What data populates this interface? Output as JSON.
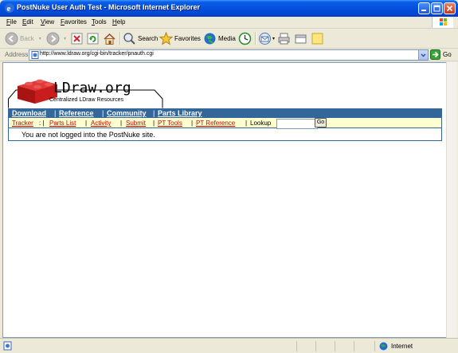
{
  "window": {
    "title": "PostNuke User Auth Test - Microsoft Internet Explorer"
  },
  "menu": {
    "items": [
      {
        "label": "File",
        "key": "F",
        "rest": "ile"
      },
      {
        "label": "Edit",
        "key": "E",
        "rest": "dit"
      },
      {
        "label": "View",
        "key": "V",
        "rest": "iew"
      },
      {
        "label": "Favorites",
        "key": "F",
        "rest": "avorites"
      },
      {
        "label": "Tools",
        "key": "T",
        "rest": "ools"
      },
      {
        "label": "Help",
        "key": "H",
        "rest": "elp"
      }
    ]
  },
  "toolbar": {
    "back_label": "Back",
    "search_label": "Search",
    "favorites_label": "Favorites",
    "media_label": "Media"
  },
  "address": {
    "label": "Address",
    "url": "http://www.ldraw.org/cgi-bin/tracker/pnauth.cgi",
    "go_label": "Go"
  },
  "page": {
    "logo_text": "LDraw.org",
    "logo_subtitle": "Centralized LDraw Resources",
    "nav": [
      "Download",
      "Reference",
      "Community",
      "Parts Library"
    ],
    "subnav": [
      "Tracker",
      "Parts List",
      "Activity",
      "Submit",
      "PT Tools",
      "PT Reference"
    ],
    "lookup_label": "Lookup",
    "lookup_value": "",
    "lookup_go": "Go",
    "message": "You are not logged into the PostNuke site."
  },
  "status": {
    "zone": "Internet"
  },
  "colors": {
    "nav_bg": "#336699",
    "subnav_bg": "#ffffd0",
    "sublink": "#cc0000",
    "brick": "#cc2222"
  }
}
